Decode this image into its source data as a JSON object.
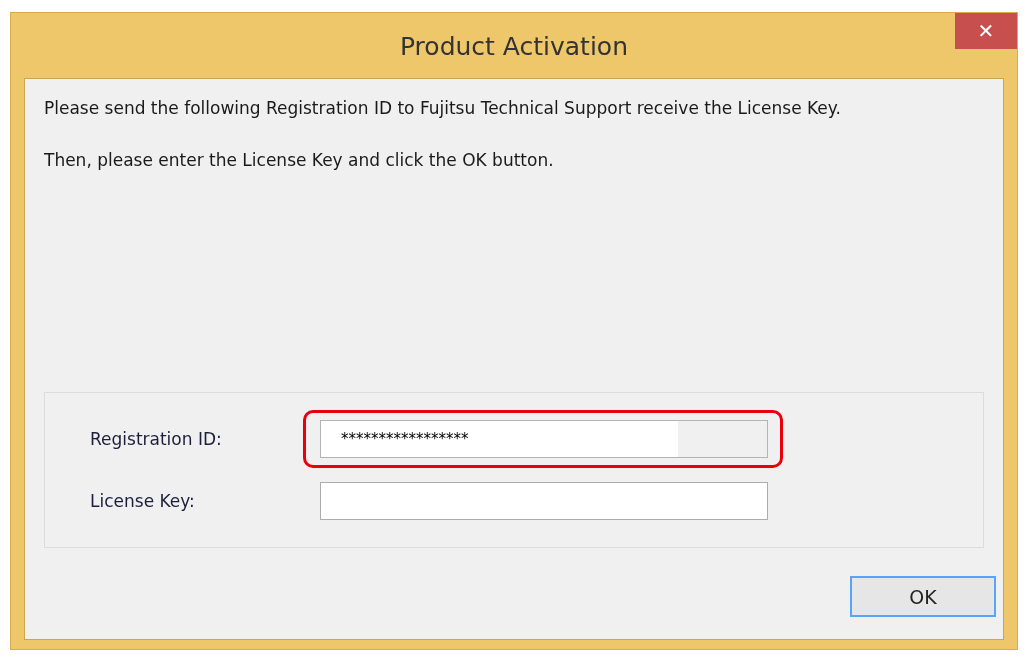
{
  "window": {
    "title": "Product Activation",
    "close_glyph": "✕"
  },
  "instructions": [
    "Please send the following Registration ID to Fujitsu Technical Support receive the License Key.",
    "Then, please enter the License Key and click the OK button."
  ],
  "fields": [
    {
      "label": "Registration ID:",
      "value": "*****************",
      "readonly": true,
      "highlighted": true
    },
    {
      "label": "License Key:",
      "readonly": false,
      "highlighted": false
    }
  ],
  "buttons": [
    {
      "label": "OK",
      "focused": true
    }
  ]
}
